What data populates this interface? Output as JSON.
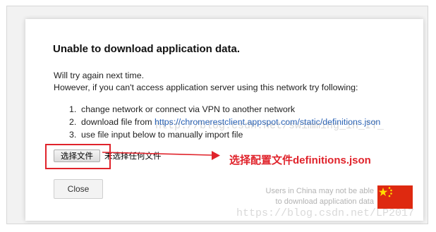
{
  "dialog": {
    "title": "Unable to download application data.",
    "retry_text": "Will try again next time.",
    "however_text": "However, if you can't access application server using this network try following:",
    "steps": [
      {
        "num": "1.",
        "text": "change network or connect via VPN to another network"
      },
      {
        "num": "2.",
        "text": "download file from ",
        "link": "https://chromerestclient.appspot.com/static/definitions.json"
      },
      {
        "num": "3.",
        "text": "use file input below to manually import file"
      }
    ],
    "file_button_label": "选择文件",
    "file_status": "未选择任何文件",
    "close_label": "Close",
    "china_note_line1": "Users in China may not be able",
    "china_note_line2": "to download application data"
  },
  "annotation": {
    "text": "选择配置文件definitions.json"
  },
  "watermarks": {
    "center": "http://blog.csdn.net/swimming_in_IT_",
    "bottom": "https://blog.csdn.net/LP2017"
  },
  "colors": {
    "annotation_red": "#e0232b",
    "link_blue": "#2962b6",
    "flag_red": "#de2910",
    "flag_star": "#ffde00"
  },
  "icons": {
    "flag": "china-flag-icon",
    "arrow": "arrow-right-icon"
  }
}
